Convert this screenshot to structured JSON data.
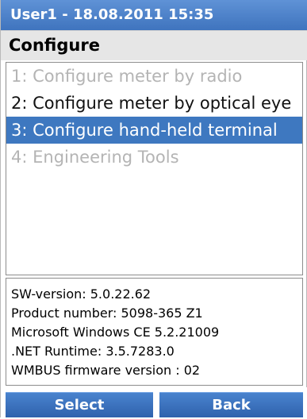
{
  "title_bar": {
    "text": "User1 - 18.08.2011 15:35"
  },
  "header": {
    "title": "Configure"
  },
  "menu": {
    "items": [
      {
        "label": "1: Configure meter by radio",
        "state": "disabled"
      },
      {
        "label": "2: Configure meter by optical eye",
        "state": "enabled"
      },
      {
        "label": "3: Configure hand-held terminal",
        "state": "selected"
      },
      {
        "label": "4: Engineering Tools",
        "state": "disabled"
      }
    ]
  },
  "info": {
    "lines": [
      "SW-version: 5.0.22.62",
      "Product number: 5098-365 Z1",
      "Microsoft Windows CE 5.2.21009",
      ".NET Runtime: 3.5.7283.0",
      "WMBUS firmware version : 02"
    ]
  },
  "softkeys": {
    "left_label": "Select",
    "right_label": "Back"
  },
  "colors": {
    "title_bar": "#3f74be",
    "selection": "#3e78c0",
    "disabled_text": "#b4b4b4",
    "softkey": "#2f62ad"
  }
}
